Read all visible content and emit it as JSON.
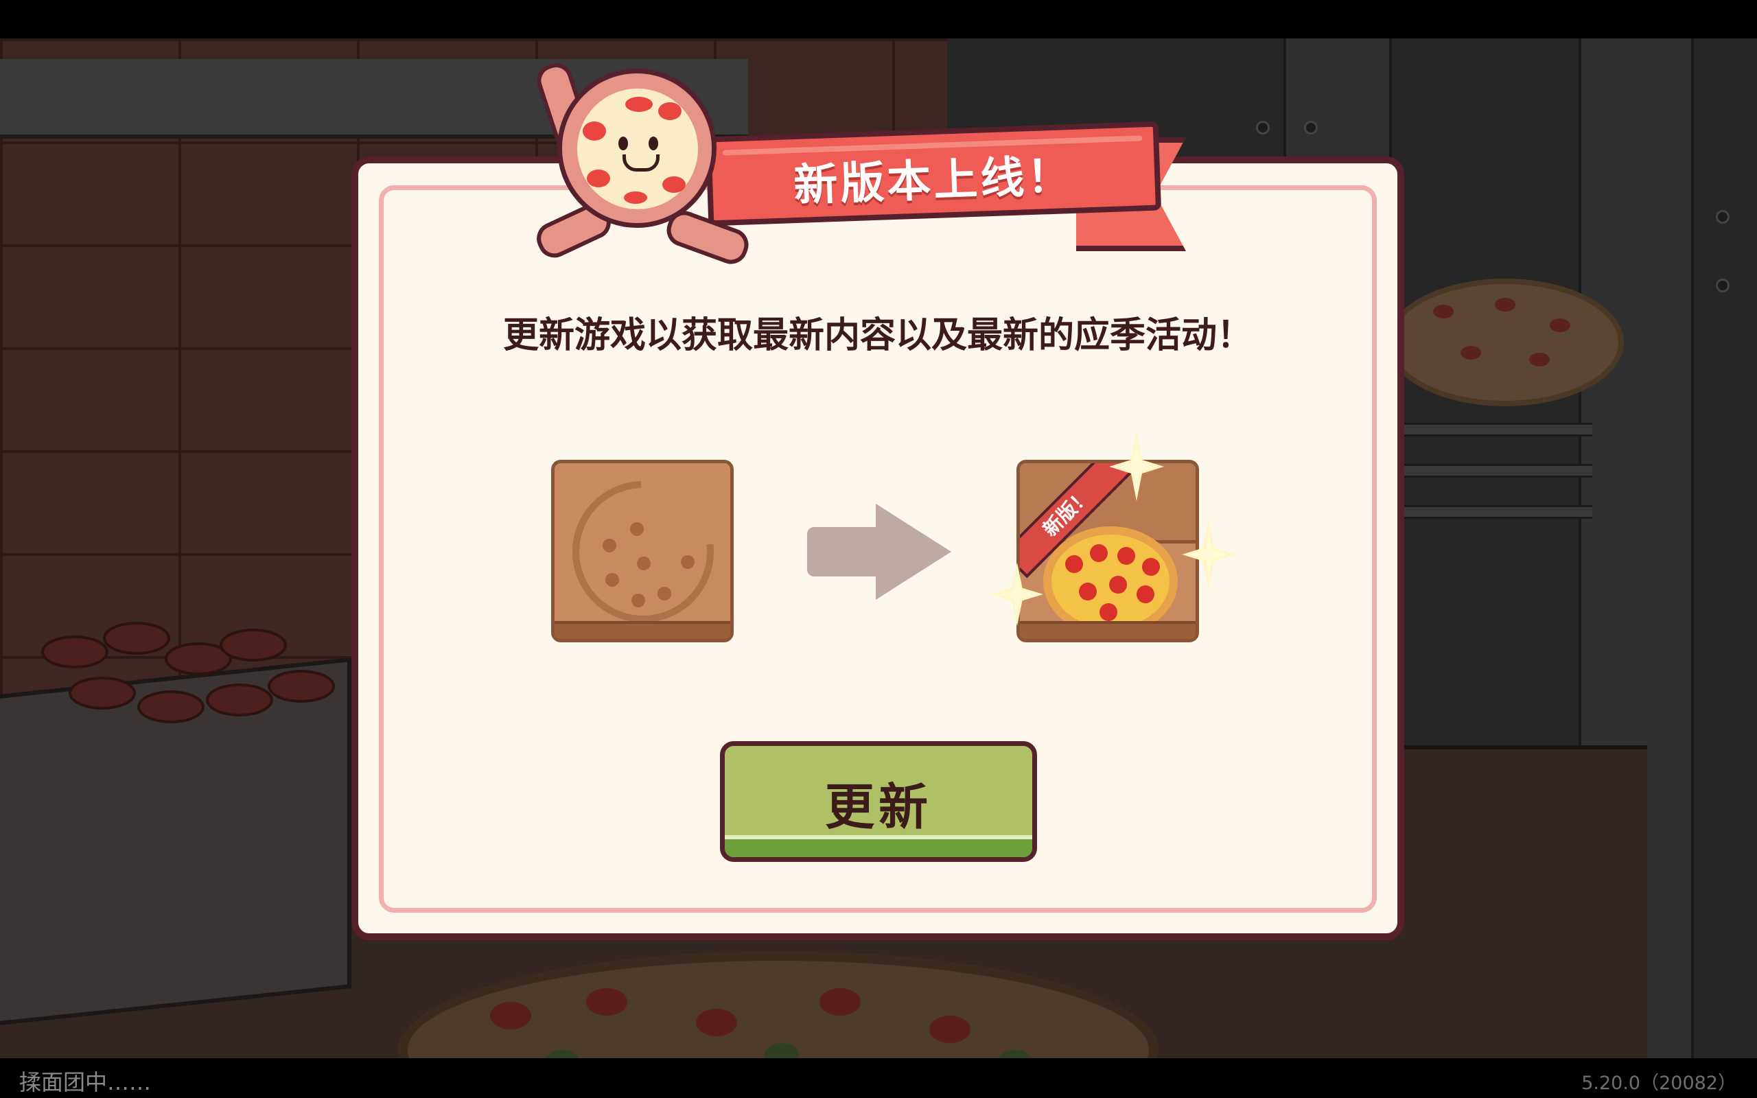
{
  "dialog": {
    "title": "新版本上线！",
    "message": "更新游戏以获取最新内容以及最新的应季活动！",
    "new_badge": "新版！",
    "update_button_label": "更新"
  },
  "footer": {
    "loading_text": "揉面团中……",
    "version_text": "5.20.0（20082）"
  },
  "colors": {
    "dialog_bg": "#fdf7ec",
    "dialog_border": "#56202d",
    "ribbon": "#ef5b55",
    "button": "#afc067",
    "button_base": "#6b9f3a"
  },
  "icons": [
    "pizza-mascot-icon",
    "old-pizza-box-icon",
    "arrow-right-icon",
    "new-pizza-box-icon",
    "sparkle-icon"
  ]
}
